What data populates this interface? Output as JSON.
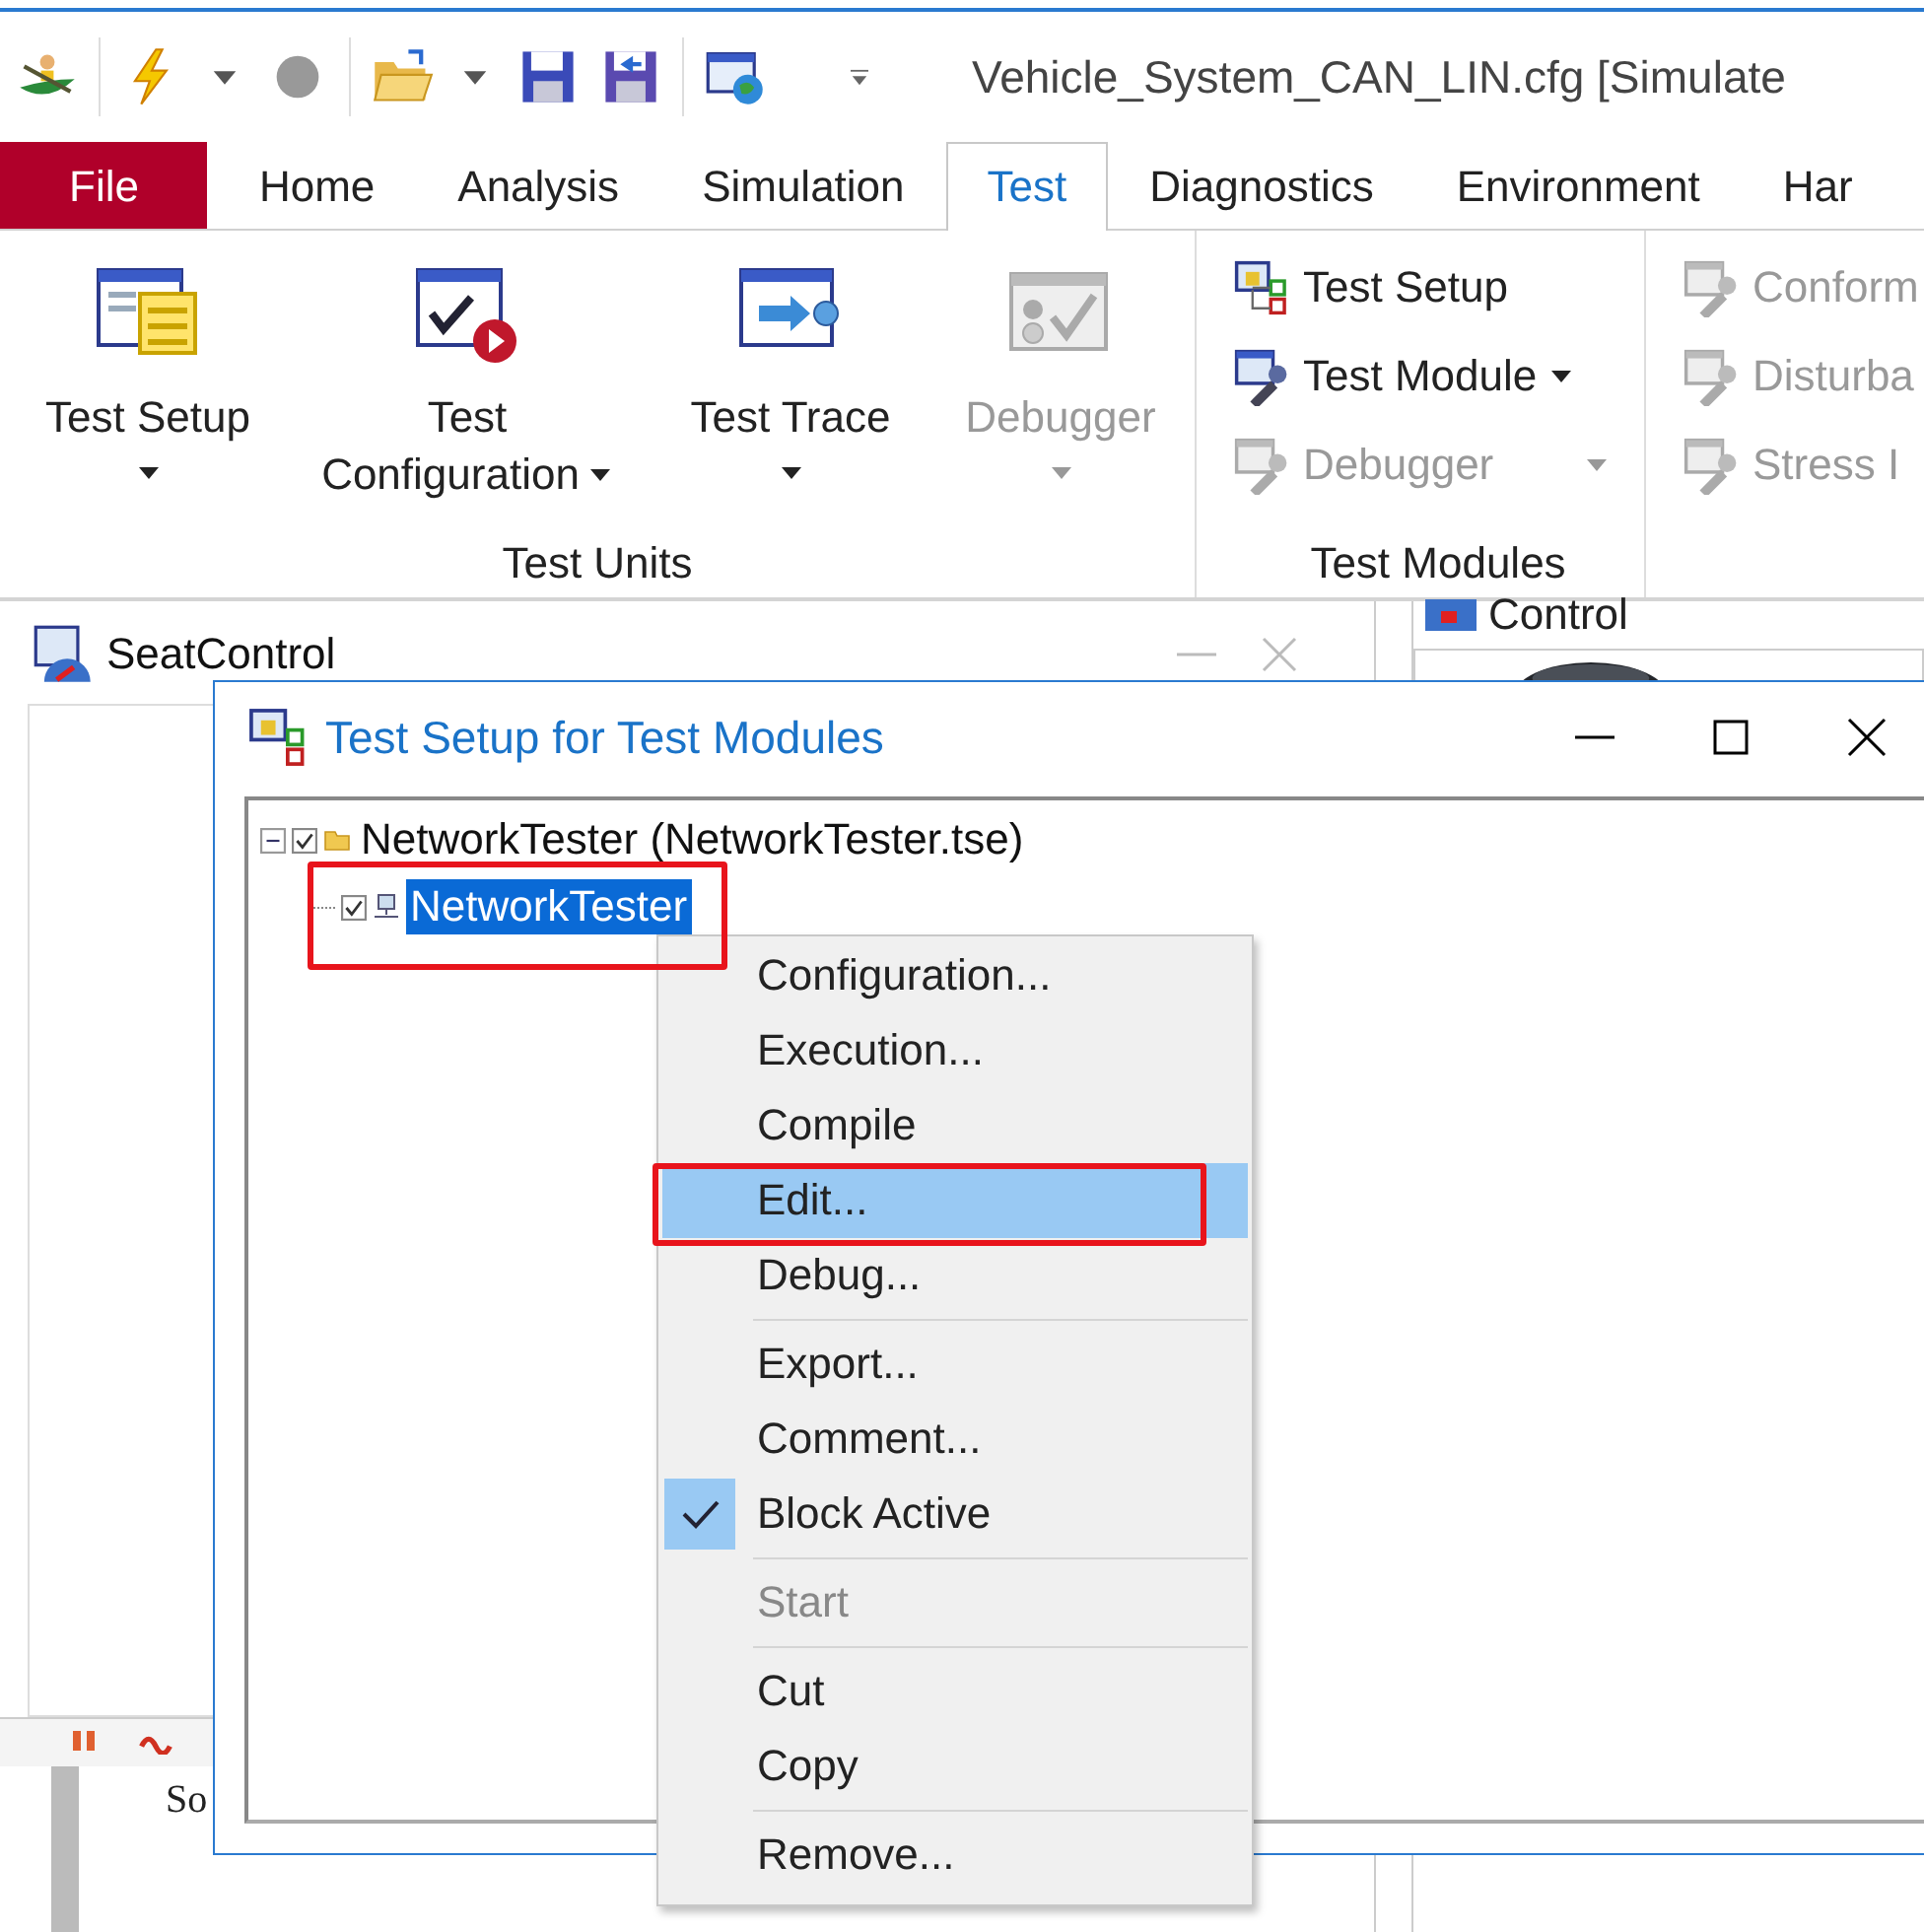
{
  "title_bar": {
    "title": "Vehicle_System_CAN_LIN.cfg [Simulate"
  },
  "ribbon_tabs": [
    {
      "label": "File",
      "kind": "file",
      "selected": false
    },
    {
      "label": "Home",
      "kind": "tab",
      "selected": false
    },
    {
      "label": "Analysis",
      "kind": "tab",
      "selected": false
    },
    {
      "label": "Simulation",
      "kind": "tab",
      "selected": false
    },
    {
      "label": "Test",
      "kind": "tab",
      "selected": true
    },
    {
      "label": "Diagnostics",
      "kind": "tab",
      "selected": false
    },
    {
      "label": "Environment",
      "kind": "tab",
      "selected": false
    },
    {
      "label": "Har",
      "kind": "tab",
      "selected": false
    }
  ],
  "ribbon_groups": [
    {
      "label": "Test Units",
      "kind": "large",
      "buttons": [
        {
          "lines": [
            "Test Setup"
          ],
          "dropdown": true,
          "disabled": false
        },
        {
          "lines": [
            "Test",
            "Configuration"
          ],
          "dropdown": true,
          "disabled": false
        },
        {
          "lines": [
            "Test Trace"
          ],
          "dropdown": true,
          "disabled": false
        },
        {
          "lines": [
            "Debugger"
          ],
          "dropdown": true,
          "disabled": true
        }
      ]
    },
    {
      "label": "Test Modules",
      "kind": "small",
      "buttons": [
        {
          "lines": [
            "Test Setup"
          ],
          "dropdown": false,
          "disabled": false
        },
        {
          "lines": [
            "Test Module"
          ],
          "dropdown": true,
          "disabled": false
        },
        {
          "lines": [
            "Debugger"
          ],
          "dropdown": true,
          "disabled": true
        }
      ]
    },
    {
      "kind": "small",
      "buttons": [
        {
          "lines": [
            "Conform"
          ],
          "dropdown": false,
          "disabled": true
        },
        {
          "lines": [
            "Disturba"
          ],
          "dropdown": false,
          "disabled": true
        },
        {
          "lines": [
            "Stress I"
          ],
          "dropdown": false,
          "disabled": true
        }
      ]
    }
  ],
  "seat_window": {
    "title": "SeatControl",
    "status_text": "So"
  },
  "control_window": {
    "title": "Control"
  },
  "dialog": {
    "title": "Test Setup for Test Modules",
    "tree": [
      {
        "label": "NetworkTester  (NetworkTester.tse)",
        "kind": "suite",
        "expanded": true,
        "checked": true,
        "selected": false,
        "children": [
          {
            "label": "NetworkTester",
            "kind": "module",
            "checked": true,
            "selected": true,
            "marked": true
          }
        ]
      }
    ]
  },
  "context_menu": [
    {
      "kind": "item",
      "label": "Configuration...",
      "selected": false,
      "checked": false,
      "disabled": false,
      "marked": false
    },
    {
      "kind": "item",
      "label": "Execution...",
      "selected": false,
      "checked": false,
      "disabled": false,
      "marked": false
    },
    {
      "kind": "item",
      "label": "Compile",
      "selected": false,
      "checked": false,
      "disabled": false,
      "marked": false
    },
    {
      "kind": "item",
      "label": "Edit...",
      "selected": true,
      "checked": false,
      "disabled": false,
      "marked": true
    },
    {
      "kind": "item",
      "label": "Debug...",
      "selected": false,
      "checked": false,
      "disabled": false,
      "marked": false
    },
    {
      "kind": "separator"
    },
    {
      "kind": "item",
      "label": "Export...",
      "selected": false,
      "checked": false,
      "disabled": false,
      "marked": false
    },
    {
      "kind": "item",
      "label": "Comment...",
      "selected": false,
      "checked": false,
      "disabled": false,
      "marked": false
    },
    {
      "kind": "item",
      "label": "Block Active",
      "selected": false,
      "checked": true,
      "disabled": false,
      "marked": false
    },
    {
      "kind": "separator"
    },
    {
      "kind": "item",
      "label": "Start",
      "selected": false,
      "checked": false,
      "disabled": true,
      "marked": false
    },
    {
      "kind": "separator"
    },
    {
      "kind": "item",
      "label": "Cut",
      "selected": false,
      "checked": false,
      "disabled": false,
      "marked": false
    },
    {
      "kind": "item",
      "label": "Copy",
      "selected": false,
      "checked": false,
      "disabled": false,
      "marked": false
    },
    {
      "kind": "separator"
    },
    {
      "kind": "item",
      "label": "Remove...",
      "selected": false,
      "checked": false,
      "disabled": false,
      "marked": false
    }
  ]
}
